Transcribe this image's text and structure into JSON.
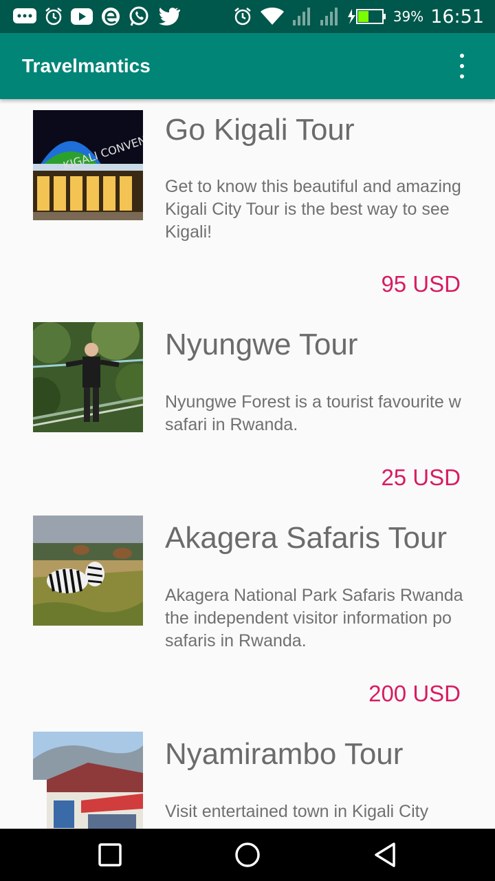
{
  "status_bar": {
    "battery": "39%",
    "time": "16:51",
    "icons": [
      "message-icon",
      "alarm-icon",
      "youtube-icon",
      "edge-icon",
      "whatsapp-icon",
      "twitter-icon",
      "alarm-clock-icon",
      "wifi-icon",
      "signal-icon",
      "signal-icon-2",
      "charging-icon"
    ]
  },
  "app_bar": {
    "title": "Travelmantics"
  },
  "tours": [
    {
      "title": "Go Kigali Tour",
      "description": "Get to know this beautiful and amazing\nKigali City Tour is the best way to see\nKigali!",
      "price": "95 USD"
    },
    {
      "title": "Nyungwe Tour",
      "description": "Nyungwe Forest is a tourist favourite w\nsafari in Rwanda.",
      "price": "25 USD"
    },
    {
      "title": "Akagera Safaris Tour",
      "description": "Akagera National Park Safaris Rwanda\nthe independent visitor information po\nsafaris in Rwanda.",
      "price": "200 USD"
    },
    {
      "title": "Nyamirambo Tour",
      "description": "Visit entertained town in Kigali City",
      "price": ""
    }
  ],
  "colors": {
    "primary": "#008577",
    "primary_dark": "#00574b",
    "accent": "#d81b60"
  }
}
